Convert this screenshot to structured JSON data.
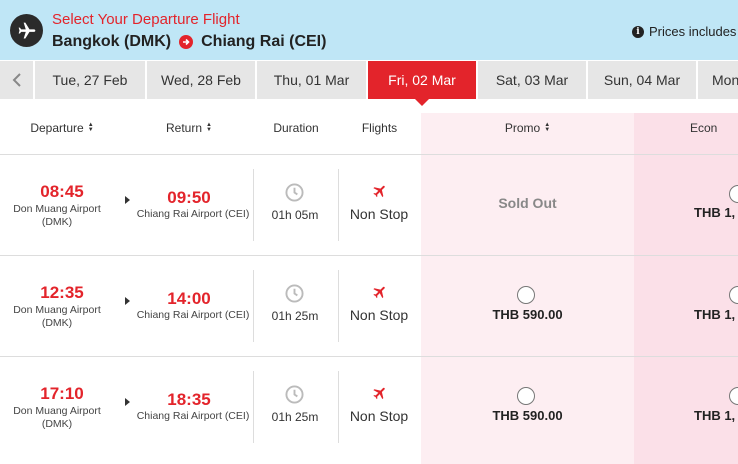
{
  "header": {
    "title": "Select Your Departure Flight",
    "origin": "Bangkok (DMK)",
    "destination": "Chiang Rai (CEI)",
    "info_text": "Prices includes"
  },
  "date_tabs": [
    {
      "label": "Tue, 27 Feb",
      "active": false
    },
    {
      "label": "Wed, 28 Feb",
      "active": false
    },
    {
      "label": "Thu, 01 Mar",
      "active": false
    },
    {
      "label": "Fri, 02 Mar",
      "active": true
    },
    {
      "label": "Sat, 03 Mar",
      "active": false
    },
    {
      "label": "Sun, 04 Mar",
      "active": false
    },
    {
      "label": "Mon",
      "active": false
    }
  ],
  "columns": {
    "departure": "Departure",
    "return": "Return",
    "duration": "Duration",
    "flights": "Flights",
    "promo": "Promo",
    "economy": "Econ"
  },
  "flights": [
    {
      "depart_time": "08:45",
      "depart_airport": "Don Muang Airport",
      "depart_code": "(DMK)",
      "arrive_time": "09:50",
      "arrive_airport": "Chiang Rai Airport (CEI)",
      "duration": "01h 05m",
      "stops": "Non Stop",
      "promo": "Sold Out",
      "promo_sold_out": true,
      "economy": "THB 1,"
    },
    {
      "depart_time": "12:35",
      "depart_airport": "Don Muang Airport",
      "depart_code": "(DMK)",
      "arrive_time": "14:00",
      "arrive_airport": "Chiang Rai Airport (CEI)",
      "duration": "01h 25m",
      "stops": "Non Stop",
      "promo": "THB 590.00",
      "promo_sold_out": false,
      "economy": "THB 1,"
    },
    {
      "depart_time": "17:10",
      "depart_airport": "Don Muang Airport",
      "depart_code": "(DMK)",
      "arrive_time": "18:35",
      "arrive_airport": "Chiang Rai Airport (CEI)",
      "duration": "01h 25m",
      "stops": "Non Stop",
      "promo": "THB 590.00",
      "promo_sold_out": false,
      "economy": "THB 1,"
    }
  ],
  "colors": {
    "accent": "#e3242b",
    "header_bg": "#bfe6f6",
    "promo_bg": "#fdeef2",
    "economy_bg": "#fbe0e8"
  }
}
